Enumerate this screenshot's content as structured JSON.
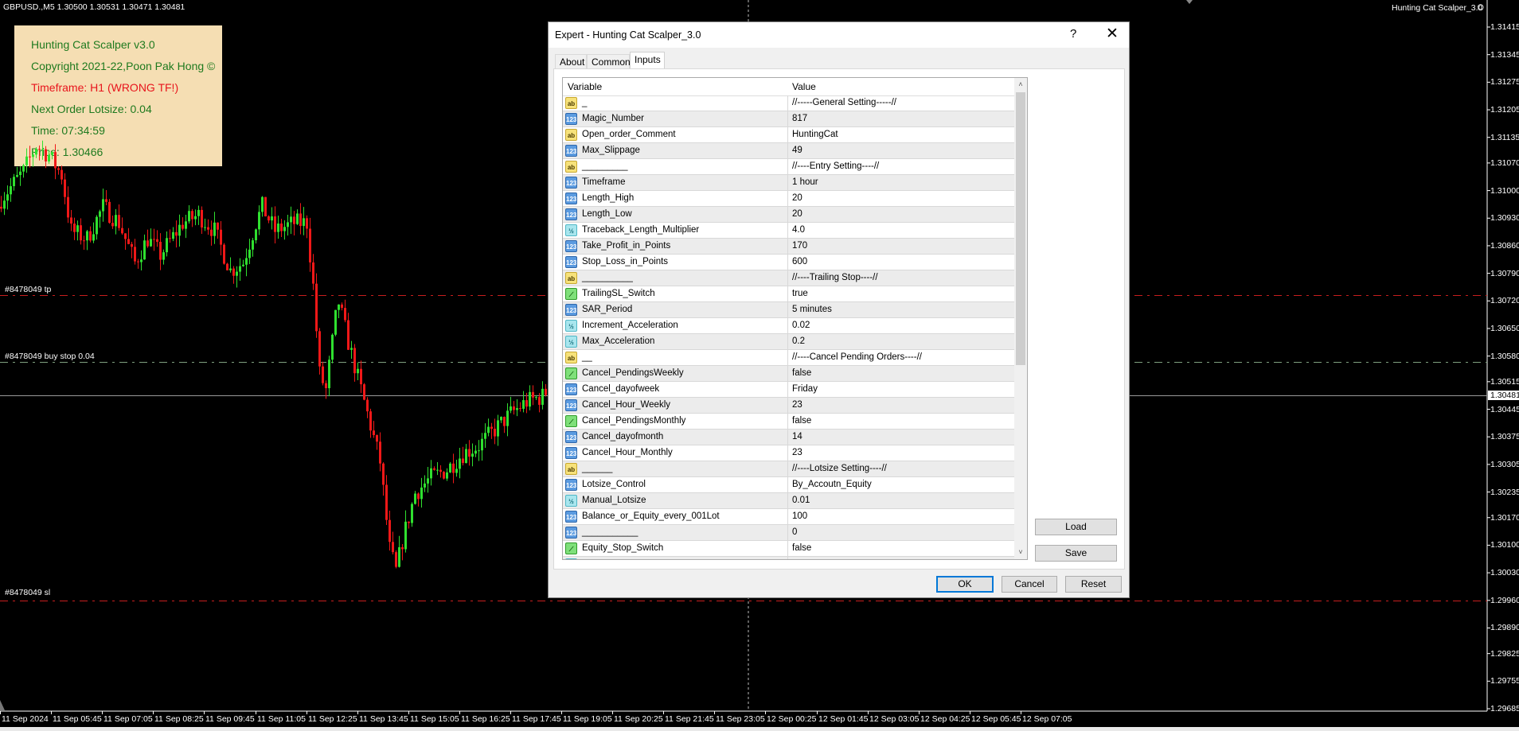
{
  "chart": {
    "symbol_header": "GBPUSD.,M5  1.30500 1.30531 1.30471 1.30481",
    "expert_label": "Hunting Cat Scalper_3.0",
    "expert_status_icon": "smiley-icon",
    "colors": {
      "bull": "#2fe02f",
      "bear": "#f01818",
      "background": "#000000",
      "tp_line": "#c81e1e",
      "sl_line": "#c81e1e",
      "pending_line": "#7fa07f",
      "bid_line": "#9a9a9a"
    },
    "price_axis": [
      "1.31415",
      "1.31345",
      "1.31275",
      "1.31205",
      "1.31135",
      "1.31070",
      "1.31000",
      "1.30930",
      "1.30860",
      "1.30790",
      "1.30720",
      "1.30650",
      "1.30580",
      "1.30515",
      "1.30445",
      "1.30375",
      "1.30305",
      "1.30235",
      "1.30170",
      "1.30100",
      "1.30030",
      "1.29960",
      "1.29890",
      "1.29825",
      "1.29755",
      "1.29685"
    ],
    "current_price": "1.30481",
    "time_axis": [
      "11 Sep 2024",
      "11 Sep 05:45",
      "11 Sep 07:05",
      "11 Sep 08:25",
      "11 Sep 09:45",
      "11 Sep 11:05",
      "11 Sep 12:25",
      "11 Sep 13:45",
      "11 Sep 15:05",
      "11 Sep 16:25",
      "11 Sep 17:45",
      "11 Sep 19:05",
      "11 Sep 20:25",
      "11 Sep 21:45",
      "11 Sep 23:05",
      "12 Sep 00:25",
      "12 Sep 01:45",
      "12 Sep 03:05",
      "12 Sep 04:25",
      "12 Sep 05:45",
      "12 Sep 07:05"
    ],
    "order_lines": {
      "tp": {
        "label": "#8478049 tp",
        "price": 1.30735
      },
      "buy_stop": {
        "label": "#8478049 buy stop 0.04",
        "price": 1.30566
      },
      "sl": {
        "label": "#8478049 sl",
        "price": 1.2996
      }
    },
    "close_path": [
      [
        0,
        1.30979
      ],
      [
        7,
        1.31049
      ],
      [
        11,
        1.31114
      ],
      [
        15,
        1.3109
      ],
      [
        19,
        1.31039
      ],
      [
        22,
        1.30898
      ],
      [
        27,
        1.30878
      ],
      [
        32,
        1.30959
      ],
      [
        37,
        1.30918
      ],
      [
        42,
        1.30817
      ],
      [
        46,
        1.30878
      ],
      [
        50,
        1.30837
      ],
      [
        57,
        1.30918
      ],
      [
        62,
        1.30938
      ],
      [
        67,
        1.30898
      ],
      [
        72,
        1.30797
      ],
      [
        76,
        1.30817
      ],
      [
        80,
        1.30918
      ],
      [
        82,
        1.30959
      ],
      [
        86,
        1.30898
      ],
      [
        92,
        1.30918
      ],
      [
        96,
        1.30918
      ],
      [
        98,
        1.30757
      ],
      [
        100,
        1.30535
      ],
      [
        102,
        1.30494
      ],
      [
        105,
        1.30676
      ],
      [
        106,
        1.30716
      ],
      [
        109,
        1.30615
      ],
      [
        111,
        1.30555
      ],
      [
        115,
        1.30434
      ],
      [
        119,
        1.30312
      ],
      [
        122,
        1.3009
      ],
      [
        124,
        1.30034
      ],
      [
        126,
        1.30111
      ],
      [
        130,
        1.30232
      ],
      [
        135,
        1.30272
      ],
      [
        140,
        1.30292
      ],
      [
        145,
        1.30333
      ],
      [
        150,
        1.30353
      ],
      [
        155,
        1.30393
      ],
      [
        160,
        1.30434
      ],
      [
        165,
        1.30464
      ],
      [
        171,
        1.30481
      ]
    ]
  },
  "info_panel": {
    "lines": [
      "Hunting Cat Scalper v3.0",
      "Copyright 2021-22,Poon Pak Hong ©",
      "Timeframe: H1 (WRONG TF!)",
      "Next Order Lotsize: 0.04",
      "Time: 07:34:59",
      "Price: 1.30466"
    ],
    "colors": {
      "background": "#f5deb3",
      "text": "#1f7a1f",
      "warning": "#e8141c"
    }
  },
  "dialog": {
    "title": "Expert - Hunting Cat Scalper_3.0",
    "help_label": "?",
    "close_label": "✕",
    "tabs": [
      {
        "label": "About"
      },
      {
        "label": "Common"
      },
      {
        "label": "Inputs",
        "active": true
      }
    ],
    "columns": {
      "variable": "Variable",
      "value": "Value"
    },
    "rows": [
      {
        "type": "string",
        "icon": "ab",
        "variable": "_",
        "value": "//-----General Setting-----//"
      },
      {
        "type": "int",
        "icon": "123",
        "variable": "Magic_Number",
        "value": "817"
      },
      {
        "type": "string",
        "icon": "ab",
        "variable": "Open_order_Comment",
        "value": "HuntingCat"
      },
      {
        "type": "int",
        "icon": "123",
        "variable": "Max_Slippage",
        "value": "49"
      },
      {
        "type": "string",
        "icon": "ab",
        "variable": "_________",
        "value": "//----Entry Setting----//"
      },
      {
        "type": "int",
        "icon": "123",
        "variable": "Timeframe",
        "value": "1 hour"
      },
      {
        "type": "int",
        "icon": "123",
        "variable": "Length_High",
        "value": "20"
      },
      {
        "type": "int",
        "icon": "123",
        "variable": "Length_Low",
        "value": "20"
      },
      {
        "type": "double",
        "icon": "½",
        "variable": "Traceback_Length_Multiplier",
        "value": "4.0"
      },
      {
        "type": "int",
        "icon": "123",
        "variable": "Take_Profit_in_Points",
        "value": "170"
      },
      {
        "type": "int",
        "icon": "123",
        "variable": "Stop_Loss_in_Points",
        "value": "600"
      },
      {
        "type": "string",
        "icon": "ab",
        "variable": "__________",
        "value": "//----Trailing Stop----//"
      },
      {
        "type": "bool",
        "icon": "⟋",
        "variable": "TrailingSL_Switch",
        "value": "true"
      },
      {
        "type": "int",
        "icon": "123",
        "variable": "SAR_Period",
        "value": "5 minutes"
      },
      {
        "type": "double",
        "icon": "½",
        "variable": "Increment_Acceleration",
        "value": "0.02"
      },
      {
        "type": "double",
        "icon": "½",
        "variable": "Max_Acceleration",
        "value": "0.2"
      },
      {
        "type": "string",
        "icon": "ab",
        "variable": "__",
        "value": "//----Cancel Pending Orders----//"
      },
      {
        "type": "bool",
        "icon": "⟋",
        "variable": "Cancel_PendingsWeekly",
        "value": "false"
      },
      {
        "type": "int",
        "icon": "123",
        "variable": "Cancel_dayofweek",
        "value": "Friday"
      },
      {
        "type": "int",
        "icon": "123",
        "variable": "Cancel_Hour_Weekly",
        "value": "23"
      },
      {
        "type": "bool",
        "icon": "⟋",
        "variable": "Cancel_PendingsMonthly",
        "value": "false"
      },
      {
        "type": "int",
        "icon": "123",
        "variable": "Cancel_dayofmonth",
        "value": "14"
      },
      {
        "type": "int",
        "icon": "123",
        "variable": "Cancel_Hour_Monthly",
        "value": "23"
      },
      {
        "type": "string",
        "icon": "ab",
        "variable": "______",
        "value": "//----Lotsize Setting----//"
      },
      {
        "type": "int",
        "icon": "123",
        "variable": "Lotsize_Control",
        "value": "By_Accoutn_Equity"
      },
      {
        "type": "double",
        "icon": "½",
        "variable": "Manual_Lotsize",
        "value": "0.01"
      },
      {
        "type": "int",
        "icon": "123",
        "variable": "Balance_or_Equity_every_001Lot",
        "value": "100"
      },
      {
        "type": "int",
        "icon": "123",
        "variable": "___________",
        "value": "0"
      },
      {
        "type": "bool",
        "icon": "⟋",
        "variable": "Equity_Stop_Switch",
        "value": "false"
      },
      {
        "type": "double",
        "icon": "½",
        "variable": "",
        "value": ""
      }
    ],
    "scroll_up": "˄",
    "scroll_down": "˅",
    "buttons": {
      "load": "Load",
      "save": "Save",
      "ok": "OK",
      "cancel": "Cancel",
      "reset": "Reset"
    }
  }
}
